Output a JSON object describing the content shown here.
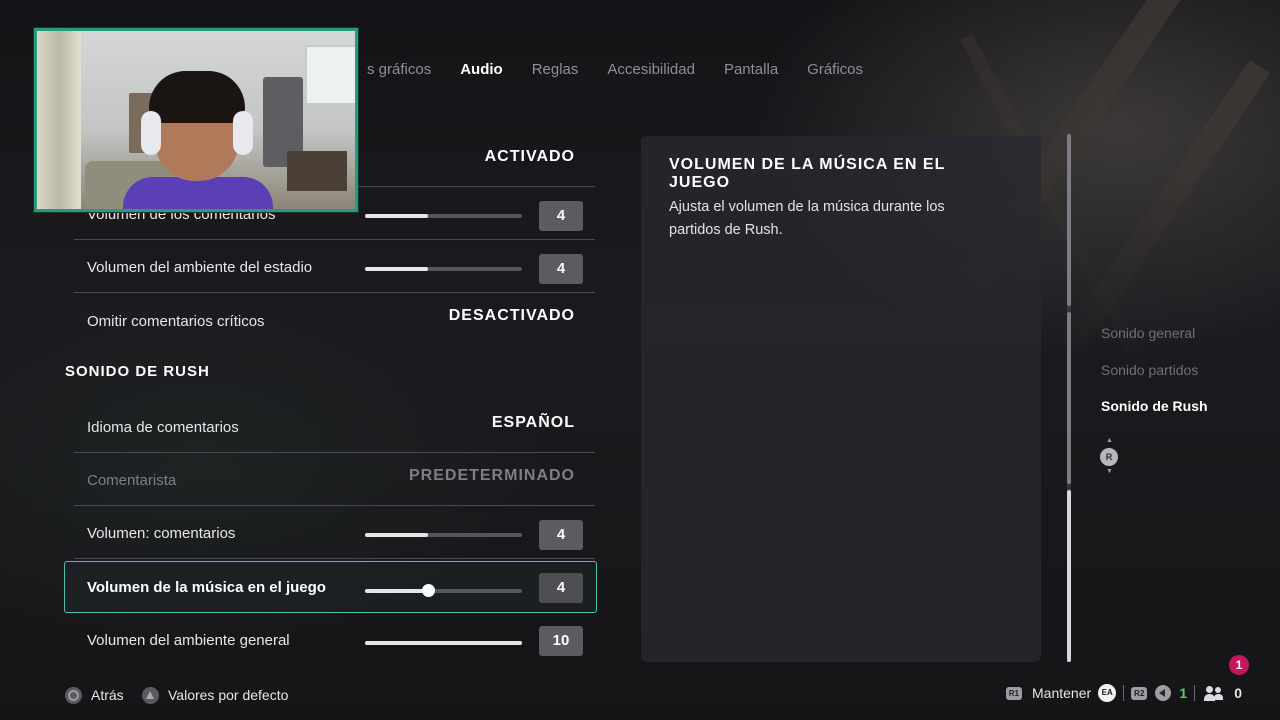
{
  "tabs": [
    {
      "label": "s gráficos",
      "active": false
    },
    {
      "label": "Audio",
      "active": true
    },
    {
      "label": "Reglas",
      "active": false
    },
    {
      "label": "Accesibilidad",
      "active": false
    },
    {
      "label": "Pantalla",
      "active": false
    },
    {
      "label": "Gráficos",
      "active": false
    }
  ],
  "settings": {
    "top_row_value": "ACTIVADO",
    "rows": [
      {
        "label": "Volumen de los comentarios",
        "slider_level": 0.4,
        "value": "4"
      },
      {
        "label": "Volumen del ambiente del estadio",
        "slider_level": 0.4,
        "value": "4"
      },
      {
        "label": "Omitir comentarios críticos",
        "value": "DESACTIVADO"
      }
    ],
    "section_title": "SONIDO DE RUSH",
    "rush_rows": [
      {
        "label": "Idioma de comentarios",
        "value": "ESPAÑOL"
      },
      {
        "label": "Comentarista",
        "value": "PREDETERMINADO",
        "disabled": true
      },
      {
        "label": "Volumen: comentarios",
        "slider_level": 0.4,
        "value": "4"
      },
      {
        "label": "Volumen de la música en el juego",
        "slider_level": 0.4,
        "value": "4",
        "selected": true
      },
      {
        "label": "Volumen del ambiente general",
        "slider_level": 1.0,
        "value": "10"
      }
    ]
  },
  "info_panel": {
    "title": "VOLUMEN DE LA MÚSICA EN EL JUEGO",
    "description": "Ajusta el volumen de la música durante los partidos de Rush."
  },
  "right_nav": {
    "items": [
      {
        "label": "Sonido general",
        "active": false
      },
      {
        "label": "Sonido partidos",
        "active": false
      },
      {
        "label": "Sonido de Rush",
        "active": true
      }
    ],
    "stick_label": "R"
  },
  "footer": {
    "back_label": "Atrás",
    "defaults_label": "Valores por defecto",
    "r1_label": "R1",
    "hold_label": "Mantener",
    "ea_label": "EA",
    "r2_label": "R2",
    "voice_count": "1",
    "party_count": "0",
    "notification_count": "1"
  },
  "colors": {
    "accent_selected": "#49c0b3",
    "notification": "#c2185b",
    "voice_count": "#4fd06a"
  }
}
